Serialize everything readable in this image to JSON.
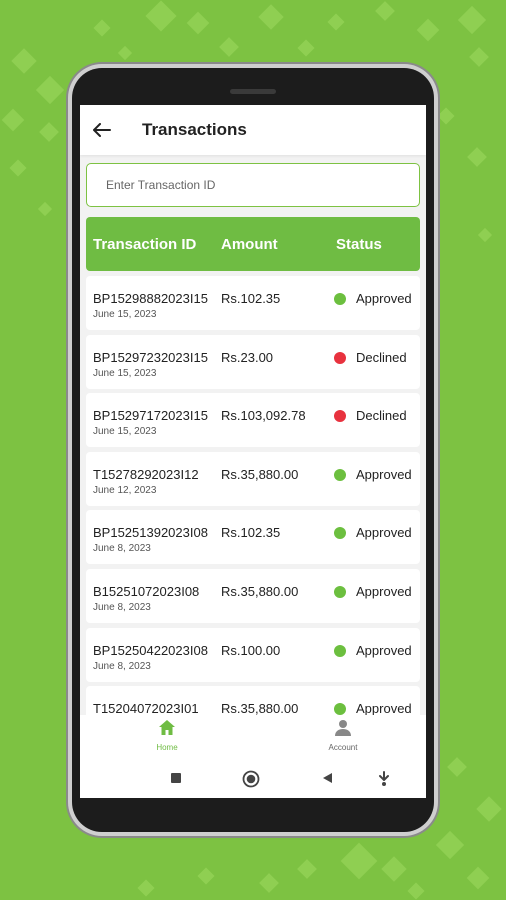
{
  "header": {
    "title": "Transactions"
  },
  "search": {
    "placeholder": "Enter Transaction ID"
  },
  "table": {
    "headers": {
      "id": "Transaction ID",
      "amount": "Amount",
      "status": "Status"
    },
    "rows": [
      {
        "id": "BP15298882023I15",
        "date": "June 15, 2023",
        "amount": "Rs.102.35",
        "status": "Approved"
      },
      {
        "id": "BP15297232023I15",
        "date": "June 15, 2023",
        "amount": "Rs.23.00",
        "status": "Declined"
      },
      {
        "id": "BP15297172023I15",
        "date": "June 15, 2023",
        "amount": "Rs.103,092.78",
        "status": "Declined"
      },
      {
        "id": "T15278292023I12",
        "date": "June 12, 2023",
        "amount": "Rs.35,880.00",
        "status": "Approved"
      },
      {
        "id": "BP15251392023I08",
        "date": "June 8, 2023",
        "amount": "Rs.102.35",
        "status": "Approved"
      },
      {
        "id": "B15251072023I08",
        "date": "June 8, 2023",
        "amount": "Rs.35,880.00",
        "status": "Approved"
      },
      {
        "id": "BP15250422023I08",
        "date": "June 8, 2023",
        "amount": "Rs.100.00",
        "status": "Approved"
      },
      {
        "id": "T15204072023I01",
        "date": "",
        "amount": "Rs.35,880.00",
        "status": "Approved"
      }
    ]
  },
  "nav": {
    "home_label": "Home",
    "account_label": "Account"
  },
  "colors": {
    "accent": "#6fbc43",
    "background": "#7dc242",
    "approved": "#6cbf3f",
    "declined": "#e8323e"
  },
  "icons": {
    "back": "arrow-left-icon",
    "home": "home-icon",
    "account": "person-icon",
    "system": [
      "square-icon",
      "circle-icon",
      "triangle-left-icon",
      "download-icon"
    ]
  }
}
